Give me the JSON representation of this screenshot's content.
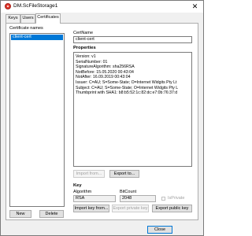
{
  "window": {
    "title": "DM.ScFileStorage1",
    "close_glyph": "✕"
  },
  "tabs": [
    {
      "label": "Keys",
      "active": false
    },
    {
      "label": "Users",
      "active": false
    },
    {
      "label": "Certificates",
      "active": true
    }
  ],
  "certificates": {
    "list_label": "Certificate names",
    "items": [
      "client-cert"
    ],
    "selected_index": 0,
    "new_label": "New",
    "delete_label": "Delete"
  },
  "cert_name": {
    "label": "CertName",
    "value": "client-cert"
  },
  "properties": {
    "heading": "Properties",
    "lines": [
      "Version: v1",
      "SerialNumber: 01",
      "SignatureAlgorithm: sha256RSA",
      "NotBefore: 15.05.2020 00:43:04",
      "NotAfter: 16.09.2019 00:43:04",
      "Issuer: C=AU; S=Some-State; O=Internet Widgits Pty Lt",
      "Subject: C=AU; S=Some-State; O=Internet Widgits Pty L",
      "Thumbprint with SHA1: b8:b5:52:1c:82:dc:e7:0b:76:37:d"
    ],
    "import_label": "Import from...",
    "export_label": "Export to..."
  },
  "key": {
    "heading": "Key",
    "algorithm_label": "Algorithm",
    "algorithm_value": "RSA",
    "bitcount_label": "BitCount",
    "bitcount_value": "2048",
    "isprivate_label": "IsPrivate",
    "isprivate_checked": false,
    "import_key_label": "Import key from...",
    "export_private_label": "Export private key",
    "export_public_label": "Export public key"
  },
  "footer": {
    "close_label": "Close"
  },
  "colors": {
    "selection": "#0078d7",
    "app_icon": "#e03a2f"
  }
}
